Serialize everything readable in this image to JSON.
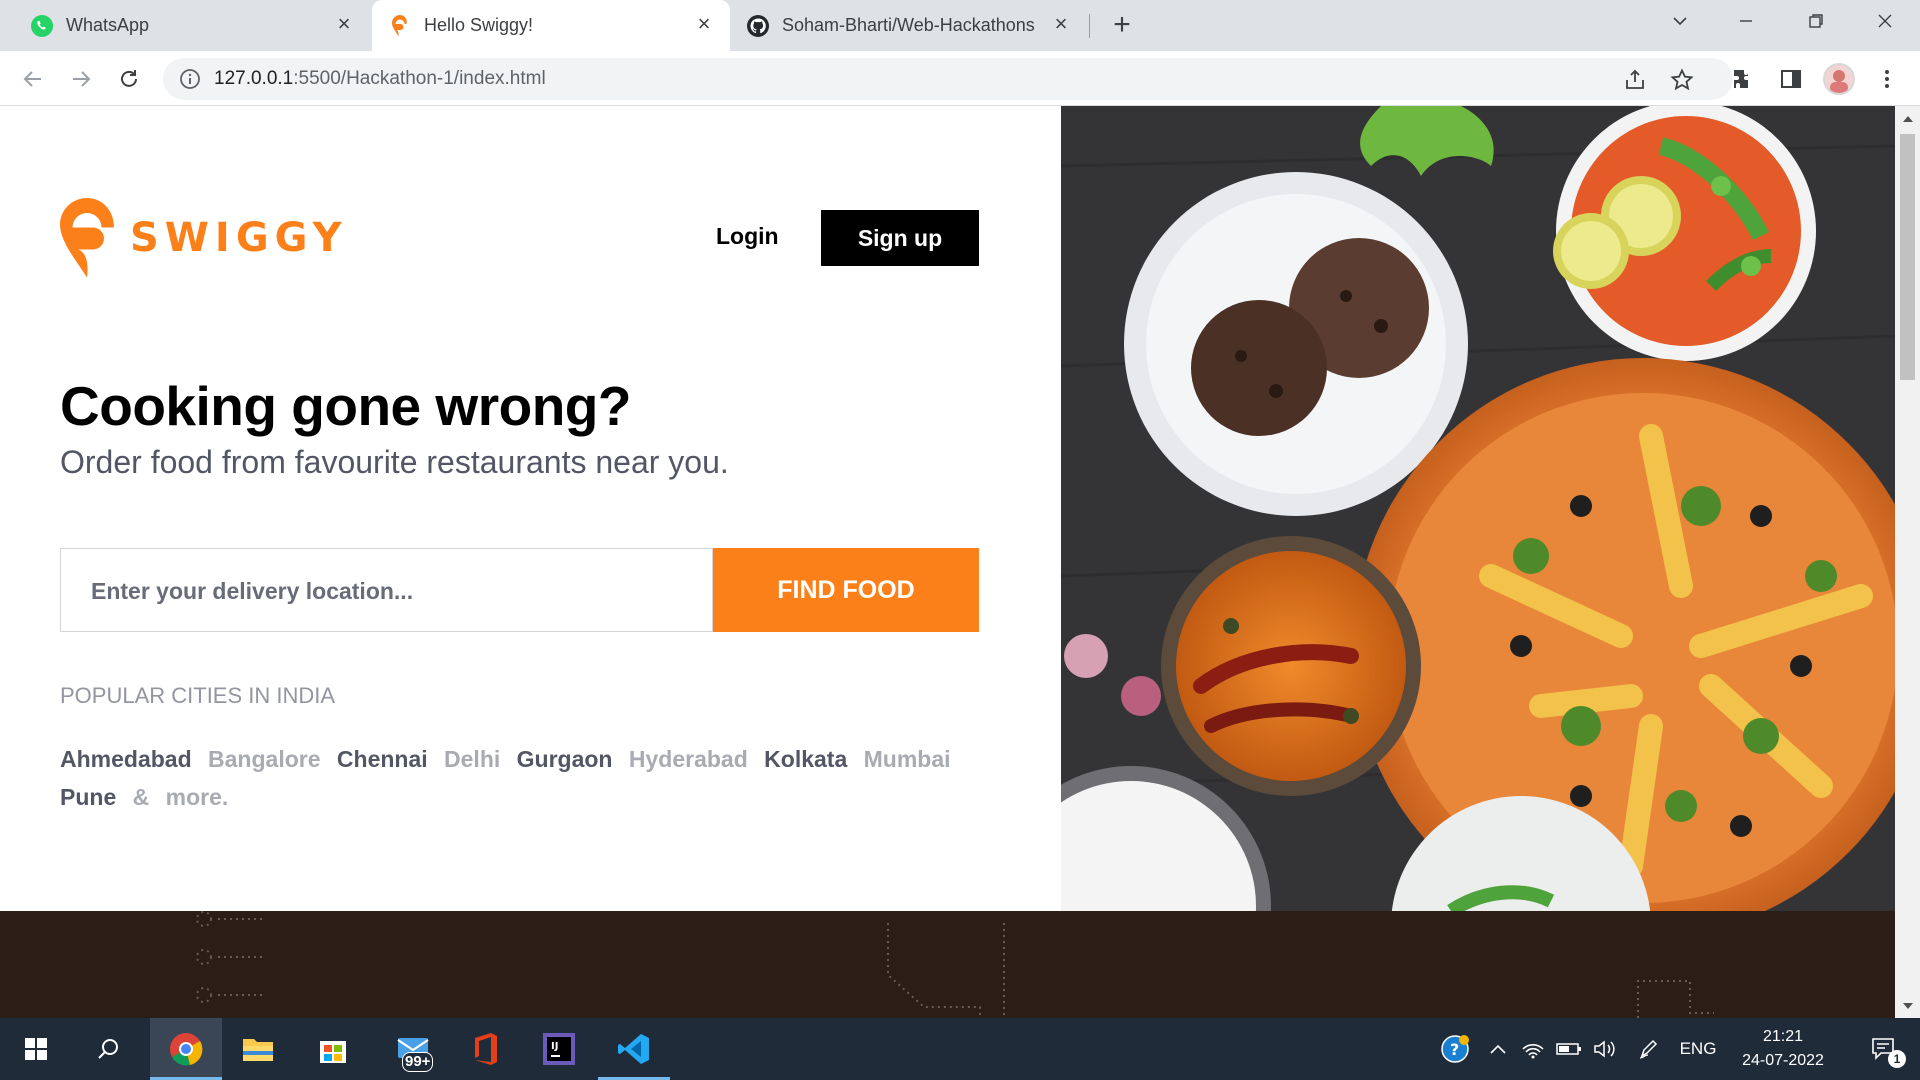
{
  "browser": {
    "tabs": [
      {
        "title": "WhatsApp",
        "icon": "whatsapp-icon",
        "active": false
      },
      {
        "title": "Hello Swiggy!",
        "icon": "swiggy-icon",
        "active": true
      },
      {
        "title": "Soham-Bharti/Web-Hackathons",
        "icon": "github-icon",
        "active": false
      }
    ],
    "url_host": "127.0.0.1",
    "url_path": ":5500/Hackathon-1/index.html"
  },
  "header": {
    "brand": "SWIGGY",
    "login_label": "Login",
    "signup_label": "Sign up"
  },
  "hero": {
    "title": "Cooking gone wrong?",
    "subtitle": "Order food from favourite restaurants near you."
  },
  "search": {
    "placeholder": "Enter your delivery location...",
    "button_label": "FIND FOOD"
  },
  "cities": {
    "heading": "POPULAR CITIES IN INDIA",
    "items": [
      {
        "name": "Ahmedabad",
        "tone": "dark"
      },
      {
        "name": "Bangalore",
        "tone": "light"
      },
      {
        "name": "Chennai",
        "tone": "dark"
      },
      {
        "name": "Delhi",
        "tone": "light"
      },
      {
        "name": "Gurgaon",
        "tone": "dark"
      },
      {
        "name": "Hyderabad",
        "tone": "light"
      },
      {
        "name": "Kolkata",
        "tone": "dark"
      },
      {
        "name": "Mumbai",
        "tone": "light"
      },
      {
        "name": "Pune",
        "tone": "dark"
      },
      {
        "name": "&",
        "tone": "light"
      },
      {
        "name": "more.",
        "tone": "light"
      }
    ]
  },
  "colors": {
    "brand_orange": "#fc8019",
    "signup_bg": "#000000",
    "bottom_band": "#2b1e16"
  },
  "taskbar": {
    "mail_badge": "99+",
    "language": "ENG",
    "time": "21:21",
    "date": "24-07-2022",
    "notification_count": "1"
  }
}
